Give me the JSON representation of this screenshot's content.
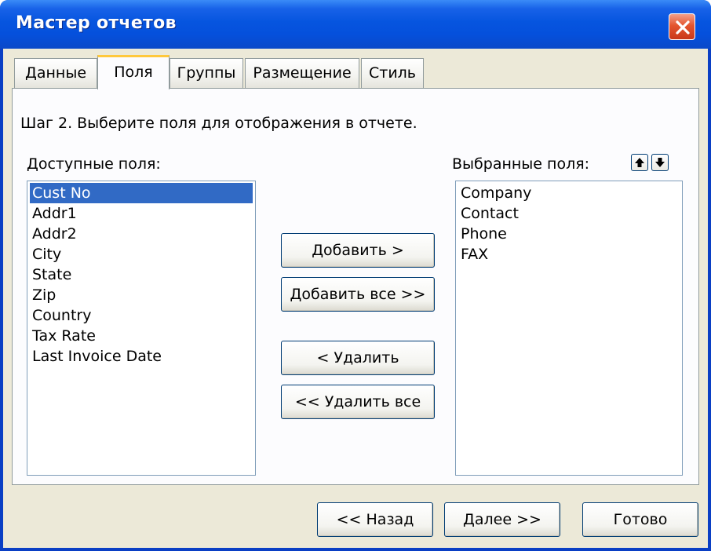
{
  "window": {
    "title": "Мастер отчетов"
  },
  "tabs": [
    {
      "label": "Данные"
    },
    {
      "label": "Поля"
    },
    {
      "label": "Группы"
    },
    {
      "label": "Размещение"
    },
    {
      "label": "Стиль"
    }
  ],
  "active_tab": "Поля",
  "step_text": "Шаг 2. Выберите поля для отображения в отчете.",
  "available": {
    "label": "Доступные поля:",
    "selected_item": "Cust No",
    "items": [
      "Cust No",
      "Addr1",
      "Addr2",
      "City",
      "State",
      "Zip",
      "Country",
      "Tax Rate",
      "Last Invoice Date"
    ]
  },
  "selected": {
    "label": "Выбранные поля:",
    "items": [
      "Company",
      "Contact",
      "Phone",
      "FAX"
    ]
  },
  "actions": {
    "add": "Добавить >",
    "add_all": "Добавить все >>",
    "remove": "< Удалить",
    "remove_all": "<< Удалить все"
  },
  "footer": {
    "back": "<< Назад",
    "next": "Далее >>",
    "finish": "Готово"
  },
  "icons": {
    "close": "close-icon",
    "move_up": "arrow-up-icon",
    "move_down": "arrow-down-icon"
  },
  "colors": {
    "titlebar": "#0655df",
    "selection": "#316ac5",
    "close_button": "#e4552e",
    "active_tab_accent": "#ffc83c"
  }
}
